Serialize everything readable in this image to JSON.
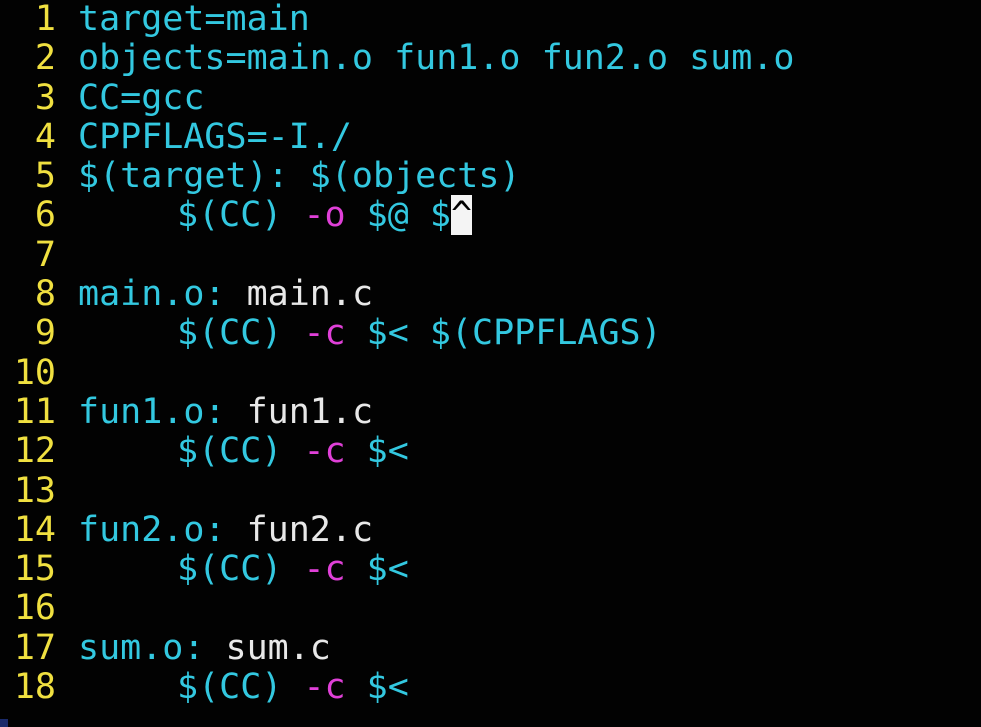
{
  "editor": {
    "lines": [
      {
        "num": "1",
        "a": "target=main"
      },
      {
        "num": "2",
        "a": "objects=main.o fun1.o fun2.o sum.o"
      },
      {
        "num": "3",
        "a": "CC=gcc"
      },
      {
        "num": "4",
        "a": "CPPFLAGS=-I./"
      },
      {
        "num": "5",
        "a": "$(target): $(objects)"
      },
      {
        "num": "6",
        "a": "$(CC)",
        "b": "-o",
        "c": "$@ $",
        "cursor": "^"
      },
      {
        "num": "7"
      },
      {
        "num": "8",
        "a": "main.o:",
        "b": "main.c"
      },
      {
        "num": "9",
        "a": "$(CC)",
        "b": "-c",
        "c": "$< $(CPPFLAGS)"
      },
      {
        "num": "10"
      },
      {
        "num": "11",
        "a": "fun1.o:",
        "b": "fun1.c"
      },
      {
        "num": "12",
        "a": "$(CC)",
        "b": "-c",
        "c": "$<"
      },
      {
        "num": "13"
      },
      {
        "num": "14",
        "a": "fun2.o:",
        "b": "fun2.c"
      },
      {
        "num": "15",
        "a": "$(CC)",
        "b": "-c",
        "c": "$<"
      },
      {
        "num": "16"
      },
      {
        "num": "17",
        "a": "sum.o:",
        "b": "sum.c"
      },
      {
        "num": "18",
        "a": "$(CC)",
        "b": "-c",
        "c": "$<"
      }
    ]
  },
  "colors": {
    "line_number": "#f0e040",
    "target_and_variables": "#33c8e0",
    "prerequisite_text": "#e8e8e8",
    "compiler_flag": "#e040d8",
    "cursor": "#f4f4f4",
    "background": "#020202"
  }
}
